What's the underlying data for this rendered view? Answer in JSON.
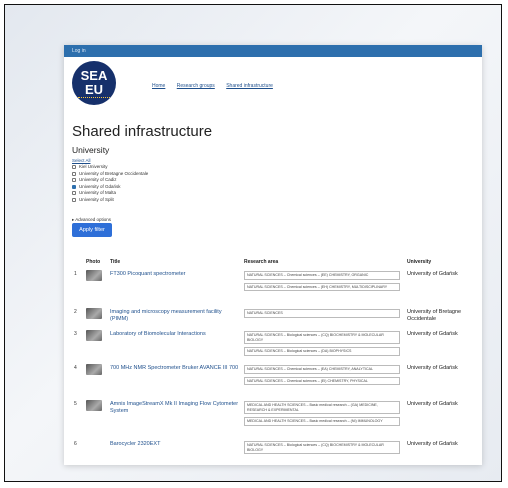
{
  "topbar": {
    "login": "Log in"
  },
  "logo": {
    "line1": "SEA",
    "line2": "EU"
  },
  "nav": [
    "Home",
    "Research groups",
    "Shared infrastructure"
  ],
  "page_title": "Shared infrastructure",
  "filter": {
    "heading": "University",
    "select_all": "Select All",
    "options": [
      {
        "label": "Kiel University",
        "checked": false
      },
      {
        "label": "University of Bretagne Occidentale",
        "checked": false
      },
      {
        "label": "University of Cadiz",
        "checked": false
      },
      {
        "label": "University of Gdańsk",
        "checked": true
      },
      {
        "label": "University of Malta",
        "checked": false
      },
      {
        "label": "University of Split",
        "checked": false
      }
    ],
    "advanced": "▸ Advanced options",
    "apply_label": "Apply filter"
  },
  "table": {
    "headers": {
      "photo": "Photo",
      "title": "Title",
      "area": "Research area",
      "university": "University"
    },
    "rows": [
      {
        "num": "1",
        "title": "FT300 Picoquant spectrometer",
        "areas": [
          "NATURAL SCIENCES – Chemical sciences – (EE) CHEMISTRY, ORGANIC",
          "NATURAL SCIENCES – Chemical sciences – (EH) CHEMISTRY, MULTIDISCIPLINARY"
        ],
        "university": "University of Gdańsk"
      },
      {
        "num": "2",
        "title": "Imaging and microscopy measurement facility (PIMM)",
        "areas": [
          "NATURAL SCIENCES"
        ],
        "university": "University of Bretagne Occidentale"
      },
      {
        "num": "3",
        "title": "Laboratory of Biomolecular Interactions",
        "areas": [
          "NATURAL SCIENCES – Biological sciences – (CQ) BIOCHEMISTRY & MOLECULAR BIOLOGY",
          "NATURAL SCIENCES – Biological sciences – (DA) BIOPHYSICS"
        ],
        "university": "University of Gdańsk"
      },
      {
        "num": "4",
        "title": "700 MHz NMR Spectrometer Bruker AVANCE III 700",
        "areas": [
          "NATURAL SCIENCES – Chemical sciences – (EA) CHEMISTRY, ANALYTICAL",
          "NATURAL SCIENCES – Chemical sciences – (EI) CHEMISTRY, PHYSICAL"
        ],
        "university": "University of Gdańsk"
      },
      {
        "num": "5",
        "title": "Amnis ImageStreamX Mk II Imaging Flow Cytometer System",
        "areas": [
          "MEDICAL AND HEALTH SCIENCES – Basic medical research – (GA) MEDICINE, RESEARCH & EXPERIMENTAL",
          "MEDICAL AND HEALTH SCIENCES – Basic medical research – (NI) IMMUNOLOGY"
        ],
        "university": "University of Gdańsk"
      },
      {
        "num": "6",
        "title": "Barocycler 2320EXT",
        "areas": [
          "NATURAL SCIENCES – Biological sciences – (CQ) BIOCHEMISTRY & MOLECULAR BIOLOGY"
        ],
        "university": "University of Gdańsk"
      }
    ]
  }
}
